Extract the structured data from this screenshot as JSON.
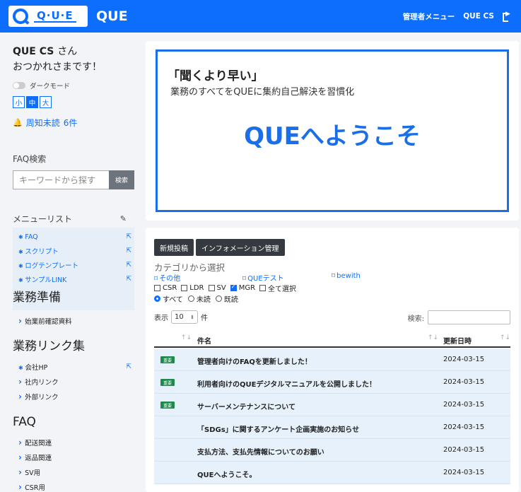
{
  "header": {
    "logo_text": "Q·U·E",
    "brand": "QUE",
    "admin_menu": "管理者メニュー",
    "user_label": "QUE CS"
  },
  "sidebar": {
    "user_name": "QUE CS",
    "san": "さん",
    "greeting": "おつかれさまです！",
    "dark_mode_label": "ダークモード",
    "font_sizes": [
      "小",
      "中",
      "大"
    ],
    "font_size_selected": "中",
    "notice_label": "周知未読",
    "notice_count": "6件",
    "faq_search_label": "FAQ検索",
    "search_placeholder": "キーワードから探す",
    "search_button": "検索",
    "menu_list_label": "メニューリスト",
    "menu_items": [
      {
        "label": "FAQ"
      },
      {
        "label": "スクリプト"
      },
      {
        "label": "ログテンプレート"
      },
      {
        "label": "サンプルLINK"
      }
    ],
    "groups": {
      "work_prep": {
        "title": "業務準備",
        "items": [
          "始業前確認資料"
        ]
      },
      "work_links": {
        "title": "業務リンク集",
        "items": [
          "会社HP",
          "社内リンク",
          "外部リンク"
        ]
      },
      "faq": {
        "title": "FAQ",
        "items": [
          "配送関連",
          "返品関連",
          "SV用",
          "CSR用"
        ]
      }
    }
  },
  "banner": {
    "quote": "「聞くより早い」",
    "subtitle": "業務のすべてをQUEに集約自己解決を習慣化",
    "welcome": "QUEへようこそ"
  },
  "info": {
    "new_post_button": "新規投稿",
    "info_manage_button": "インフォメーション管理",
    "category_title": "カテゴリから選択",
    "category_links": [
      "その他",
      "QUEテスト",
      "bewith"
    ],
    "checkboxes": [
      {
        "label": "CSR",
        "checked": false
      },
      {
        "label": "LDR",
        "checked": false
      },
      {
        "label": "SV",
        "checked": false
      },
      {
        "label": "MGR",
        "checked": true
      },
      {
        "label": "全て選択",
        "checked": false
      }
    ],
    "radios": [
      {
        "label": "すべて",
        "selected": true
      },
      {
        "label": "未読",
        "selected": false
      },
      {
        "label": "既読",
        "selected": false
      }
    ],
    "length_prefix": "表示",
    "length_value": "10",
    "length_suffix": "件",
    "search_label": "検索:",
    "columns": {
      "title": "件名",
      "date": "更新日時"
    },
    "rows": [
      {
        "tag": "重要",
        "title": "管理者向けのFAQを更新しました！",
        "date": "2024-03-15"
      },
      {
        "tag": "重要",
        "title": "利用者向けのQUEデジタルマニュアルを公開しました！",
        "date": "2024-03-15"
      },
      {
        "tag": "重要",
        "title": "サーバーメンテナンスについて",
        "date": "2024-03-15"
      },
      {
        "tag": "",
        "title": "「SDGs」に関するアンケート企画実施のお知らせ",
        "date": "2024-03-15"
      },
      {
        "tag": "",
        "title": "支払方法、支払先情報についてのお願い",
        "date": "2024-03-15"
      },
      {
        "tag": "",
        "title": "QUEへようこそ。",
        "date": "2024-03-15"
      }
    ]
  },
  "colors": {
    "primary": "#0d6efd",
    "tag_green": "#1f8a4c",
    "dark_button": "#343a40"
  }
}
